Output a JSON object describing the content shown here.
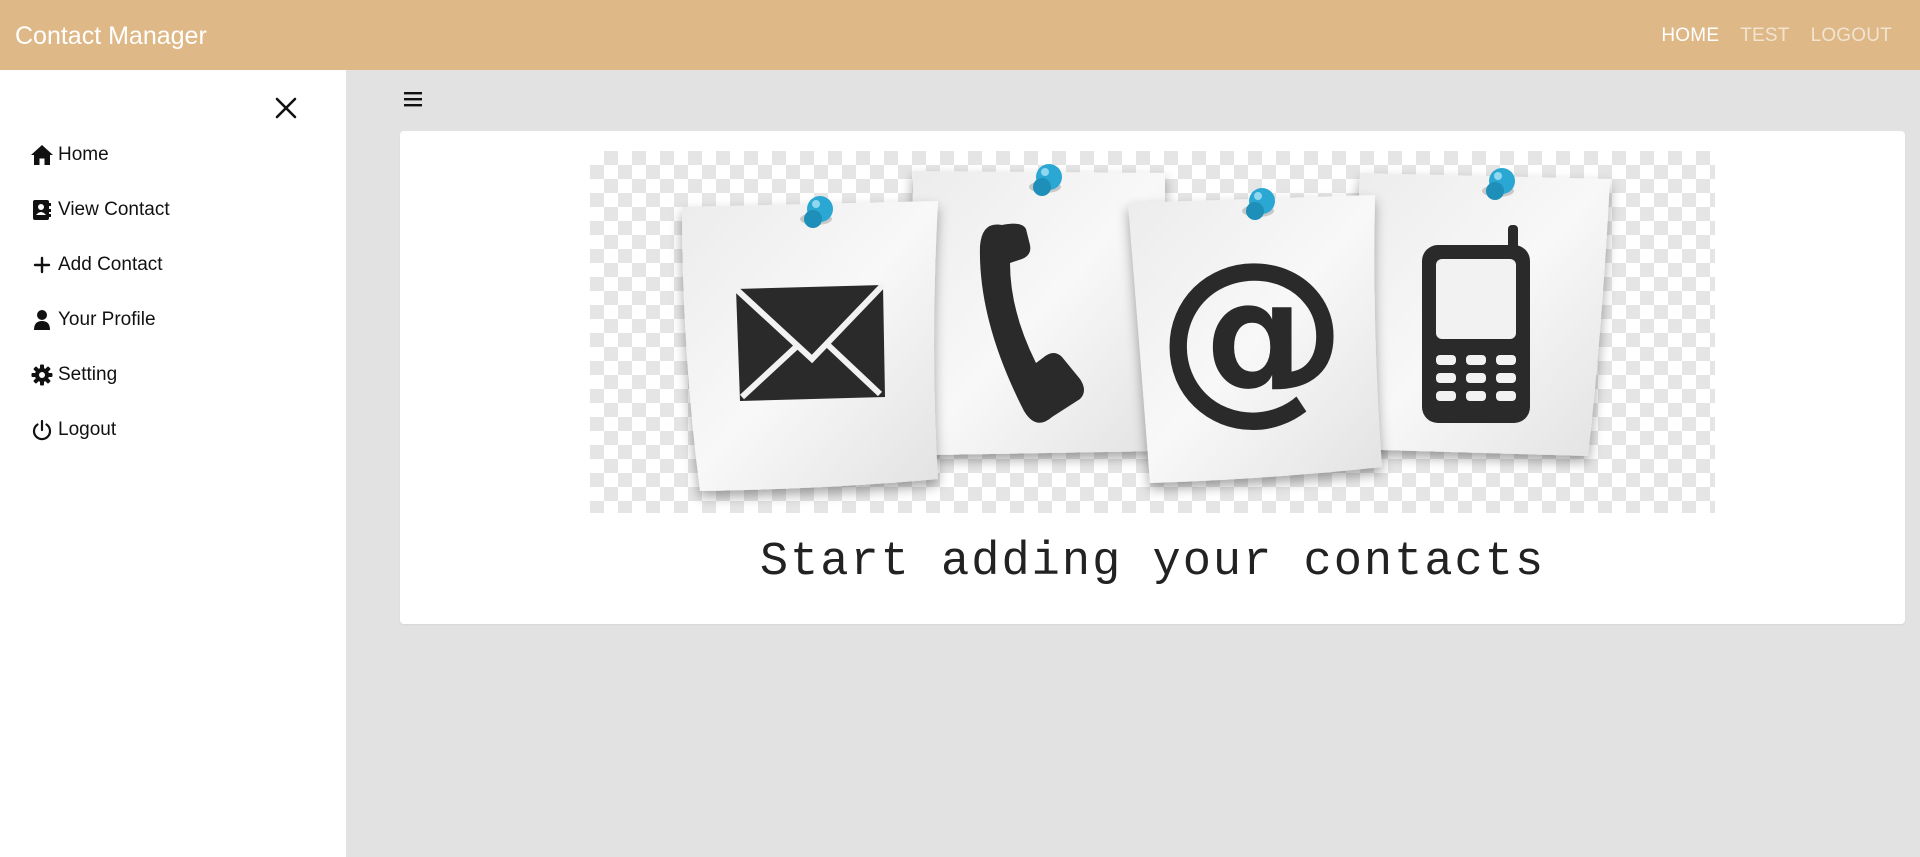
{
  "navbar": {
    "brand": "Contact Manager",
    "links": [
      {
        "label": "HOME",
        "active": true
      },
      {
        "label": "TEST",
        "active": false
      },
      {
        "label": "LOGOUT",
        "active": false
      }
    ],
    "background_color": "#deb887"
  },
  "sidebar": {
    "close_icon": "close-icon",
    "items": [
      {
        "label": "Home",
        "icon": "home-icon"
      },
      {
        "label": "View Contact",
        "icon": "contact-card-icon"
      },
      {
        "label": "Add Contact",
        "icon": "plus-icon"
      },
      {
        "label": "Your Profile",
        "icon": "user-icon"
      },
      {
        "label": "Setting",
        "icon": "gear-icon"
      },
      {
        "label": "Logout",
        "icon": "power-icon"
      }
    ]
  },
  "main": {
    "menu_icon": "hamburger-icon",
    "banner": {
      "notes": [
        "envelope-icon",
        "phone-handset-icon",
        "at-sign-icon",
        "mobile-phone-icon"
      ],
      "pin_color": "#29a8d4"
    },
    "tagline": "Start adding your contacts"
  }
}
